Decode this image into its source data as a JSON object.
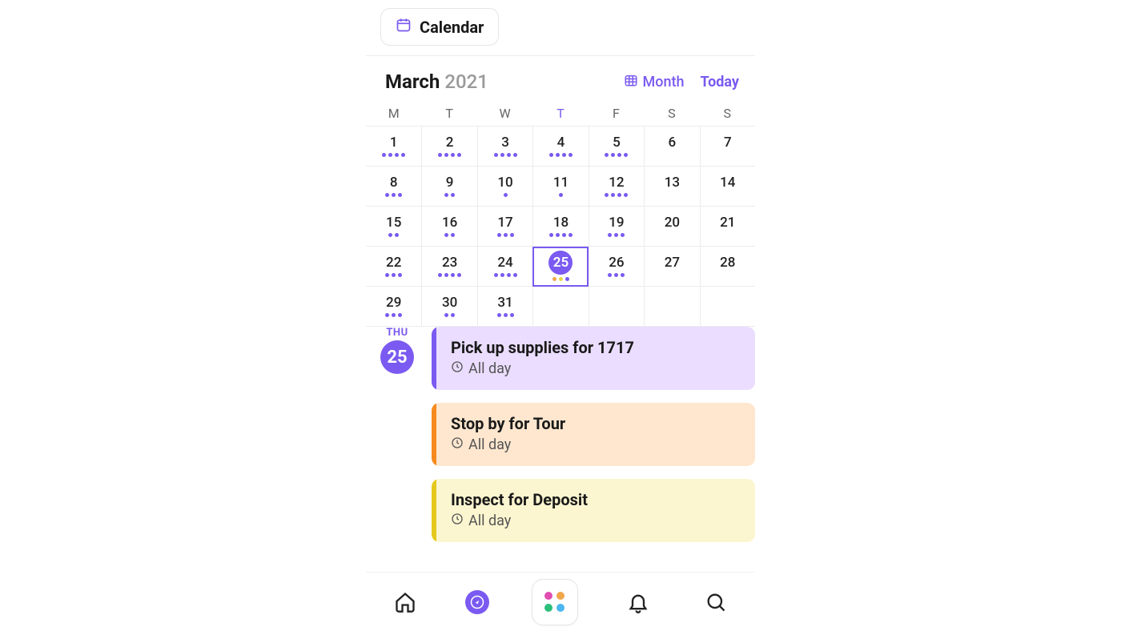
{
  "header": {
    "label": "Calendar"
  },
  "month": {
    "name": "March",
    "year": "2021"
  },
  "controls": {
    "month": "Month",
    "today": "Today"
  },
  "weekdays": [
    "M",
    "T",
    "W",
    "T",
    "F",
    "S",
    "S"
  ],
  "todayCol": 3,
  "selectedDay": 25,
  "days": [
    {
      "n": 1,
      "dots": 4
    },
    {
      "n": 2,
      "dots": 4
    },
    {
      "n": 3,
      "dots": 4
    },
    {
      "n": 4,
      "dots": 4
    },
    {
      "n": 5,
      "dots": 4
    },
    {
      "n": 6,
      "dots": 0
    },
    {
      "n": 7,
      "dots": 0
    },
    {
      "n": 8,
      "dots": 3
    },
    {
      "n": 9,
      "dots": 2
    },
    {
      "n": 10,
      "dots": 1
    },
    {
      "n": 11,
      "dots": 1
    },
    {
      "n": 12,
      "dots": 4
    },
    {
      "n": 13,
      "dots": 0
    },
    {
      "n": 14,
      "dots": 0
    },
    {
      "n": 15,
      "dots": 2
    },
    {
      "n": 16,
      "dots": 2
    },
    {
      "n": 17,
      "dots": 3
    },
    {
      "n": 18,
      "dots": 4
    },
    {
      "n": 19,
      "dots": 3
    },
    {
      "n": 20,
      "dots": 0
    },
    {
      "n": 21,
      "dots": 0
    },
    {
      "n": 22,
      "dots": 3
    },
    {
      "n": 23,
      "dots": 4
    },
    {
      "n": 24,
      "dots": 4
    },
    {
      "n": 25,
      "dots": 3,
      "selected": true,
      "dotColors": [
        "orange",
        "yellow",
        "purple"
      ]
    },
    {
      "n": 26,
      "dots": 3
    },
    {
      "n": 27,
      "dots": 0
    },
    {
      "n": 28,
      "dots": 0
    },
    {
      "n": 29,
      "dots": 3
    },
    {
      "n": 30,
      "dots": 2
    },
    {
      "n": 31,
      "dots": 3
    },
    {
      "n": "",
      "dots": 0
    },
    {
      "n": "",
      "dots": 0
    },
    {
      "n": "",
      "dots": 0
    },
    {
      "n": "",
      "dots": 0
    }
  ],
  "dayDetail": {
    "dow": "THU",
    "num": "25"
  },
  "events": [
    {
      "title": "Pick up supplies for 1717",
      "time": "All day",
      "tone": "purple"
    },
    {
      "title": "Stop by for Tour",
      "time": "All day",
      "tone": "orange"
    },
    {
      "title": "Inspect for Deposit",
      "time": "All day",
      "tone": "yellow"
    }
  ]
}
